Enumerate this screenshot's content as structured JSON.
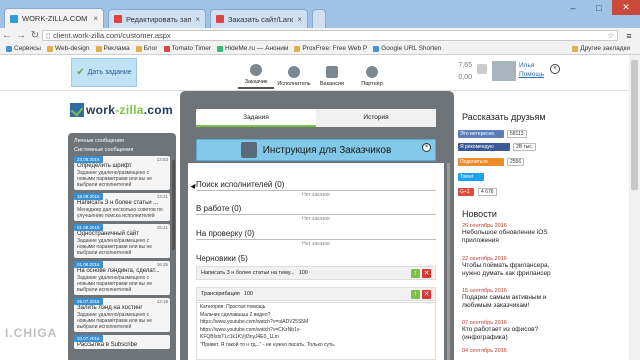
{
  "browser": {
    "tabs": [
      {
        "title": "WORK-ZILLA.COM",
        "favicon": "wz"
      },
      {
        "title": "Редактировать запись",
        "favicon": "red"
      },
      {
        "title": "Заказать сайт/Landing",
        "favicon": "red"
      }
    ],
    "url": "client.work-zilla.com/customer.aspx",
    "bookmarks": [
      "Сервисы",
      "Web-design",
      "Реклама",
      "Блог",
      "Tomato Timer",
      "HideMe.ru — Аноним",
      "ProxFree: Free Web P",
      "Google URL Shorten",
      "Другие закладки"
    ]
  },
  "header": {
    "order_button": "Дать задание",
    "nav": [
      "Заказчик",
      "Исполнитель",
      "Вакансии",
      "Партнёр"
    ],
    "balance": [
      "7,65",
      "0,00"
    ],
    "user_name": "Илья",
    "user_link": "Помощь"
  },
  "sidebar": {
    "logo": {
      "main": "work",
      "accent": "-zilla",
      "suffix": ".com"
    },
    "personal_label": "Личные сообщения",
    "system_label": "Системные сообщения",
    "messages": [
      {
        "date": "23.08.2016",
        "time": "13:53",
        "title": "Определить шрифт",
        "body": "Задание удалено/размещено с новыми параметрами или вы не выбрали исполнителей"
      },
      {
        "date": "18.08.2016",
        "time": "13:21",
        "title": "Написать 3 н более статьи ...",
        "body": "Менеджер дал несколько советов по улучшению поиска исполнителей"
      },
      {
        "date": "01.08.2016",
        "time": "15:21",
        "title": "Одностраничный сайт",
        "body": "Задание удалено/размещено с новыми параметрами или вы не выбрали исполнителей"
      },
      {
        "date": "01.08.2016",
        "time": "16:25",
        "title": "На основе лэндинга, сделат...",
        "body": "Задание удалено/размещено с новыми параметрами или вы не выбрали исполнителей"
      },
      {
        "date": "29.07.2016",
        "time": "13:19",
        "title": "Залить лэнд на хостинг",
        "body": "Задание удалено/размещено с новыми параметрами или вы не выбрали исполнителей"
      },
      {
        "date": "20.07.2016",
        "time": "",
        "title": "Рассылка в Subscribe",
        "body": ""
      }
    ]
  },
  "main": {
    "tabs": [
      "Задания",
      "История"
    ],
    "banner": "Инструкция для Заказчиков",
    "sections": [
      {
        "label": "Поиск исполнителей (0)",
        "empty": "Нет заказов"
      },
      {
        "label": "В работе (0)",
        "empty": "Нет заказов"
      },
      {
        "label": "На проверку (0)",
        "empty": "Нет заказов"
      },
      {
        "label": "Черновики (5)",
        "empty": ""
      }
    ],
    "drafts": [
      {
        "title": "Написать 3 н более статьи на тему...",
        "price": "100"
      },
      {
        "title": "Транскрибация",
        "price": "100"
      }
    ],
    "draft_detail": [
      "Категория: Простая помощь",
      "Мальчик сделавшьш 2 видео?",
      "https://www.youtube.com/watch?v=oiADV25S5M",
      "https://www.youtube.com/watch?v=CKzNb1v-",
      "KFQBIstsTLc1k1KVjt3nyJ4E0_1Lm",
      "\"Привет. Я такой то н тд...\" - не нужно писать. Только суть."
    ]
  },
  "right": {
    "share_title": "Рассказать друзьям",
    "social": [
      {
        "label": "Это интересно",
        "count": "58113",
        "color": "#5a7dbb"
      },
      {
        "label": "Я рекомендую",
        "count": "2В тыс.",
        "color": "#3b5998"
      },
      {
        "label": "Поделиться",
        "count": "2556",
        "color": "#f08b2d"
      },
      {
        "label": "Tweet",
        "count": "",
        "color": "#1da1f2"
      },
      {
        "label": "G+1",
        "count": "4 676",
        "color": "#dd4b39"
      }
    ],
    "news_title": "Новости",
    "news": [
      {
        "date": "26 сентябрь 2016",
        "text": "Небольшое обновление iOS приложения"
      },
      {
        "date": "22 сентябрь 2016",
        "text": "Чтобы поймать фрилансера, нужно думать как фрилансер"
      },
      {
        "date": "15 сентябрь 2016",
        "text": "Подарки самым активным и любимым заказчикам!"
      },
      {
        "date": "07 сентябрь 2016",
        "text": "Кто работает из офисов? (инфографика)"
      },
      {
        "date": "04 сентябрь 2016",
        "text": ""
      }
    ]
  },
  "watermark": "I.CHIGA"
}
